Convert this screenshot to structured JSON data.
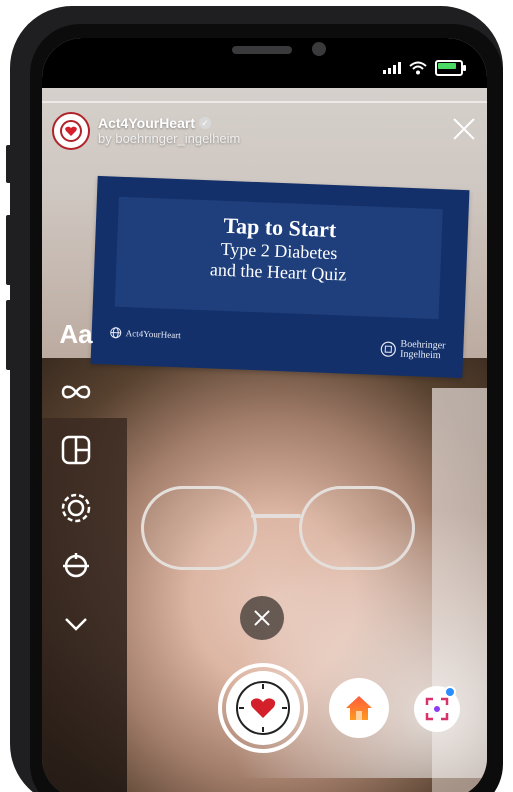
{
  "status_bar": {
    "signal_icon": "signal-icon",
    "wifi_icon": "wifi-icon",
    "battery_icon": "battery-charging-icon"
  },
  "effect": {
    "title": "Act4YourHeart",
    "creator": "by boehringer_ingelheim",
    "avatar_icon": "heart-clock-logo"
  },
  "card": {
    "title": "Tap to Start",
    "subtitle_line1": "Type 2 Diabetes",
    "subtitle_line2": "and the Heart Quiz",
    "footer_left": "Act4YourHeart",
    "footer_right_line1": "Boehringer",
    "footer_right_line2": "Ingelheim"
  },
  "left_tools": {
    "text_tool": "Aa",
    "icons": [
      "infinity-icon",
      "layout-icon",
      "hands-free-icon",
      "align-icon",
      "chevron-down-icon"
    ]
  },
  "bottom_controls": {
    "close_icon": "close-icon",
    "shutter_icon": "heart-clock-icon",
    "home_icon": "home-icon",
    "scan_icon": "scan-icon"
  }
}
